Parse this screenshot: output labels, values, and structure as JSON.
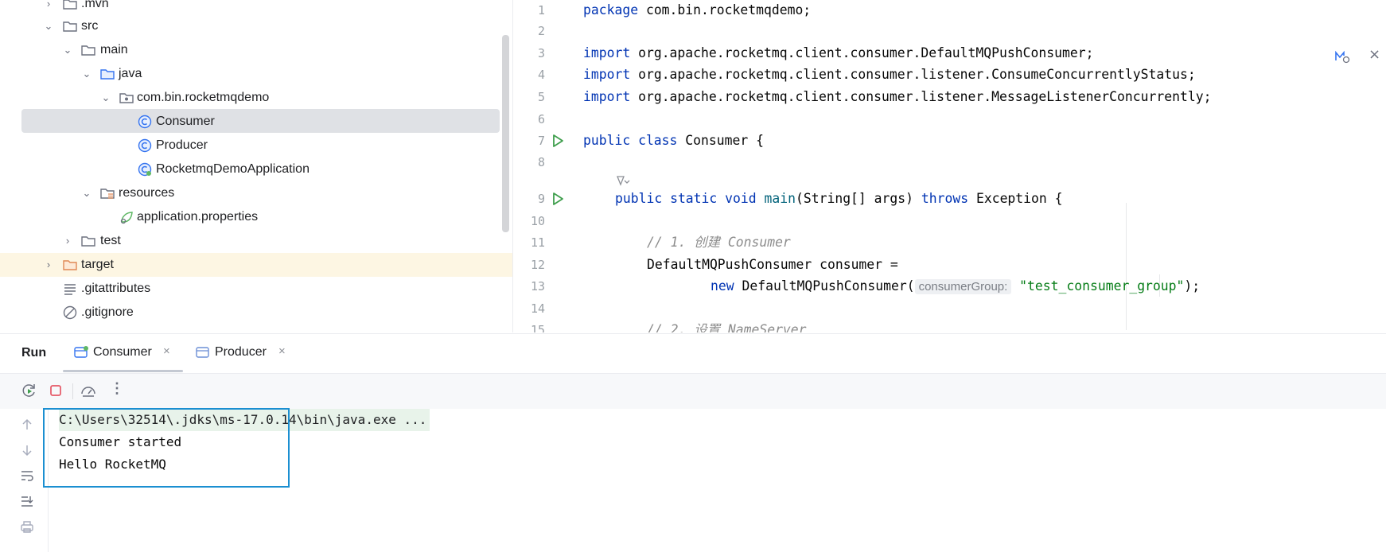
{
  "project_tree": {
    "items": [
      {
        "label": ".mvn",
        "icon": "folder-icon",
        "expanded": false
      },
      {
        "label": "src",
        "icon": "folder-icon",
        "expanded": true
      },
      {
        "label": "main",
        "icon": "folder-icon",
        "expanded": true
      },
      {
        "label": "java",
        "icon": "source-folder-icon",
        "expanded": true
      },
      {
        "label": "com.bin.rocketmqdemo",
        "icon": "package-icon",
        "expanded": true
      },
      {
        "label": "Consumer",
        "icon": "java-class-icon",
        "selected": true
      },
      {
        "label": "Producer",
        "icon": "java-class-icon"
      },
      {
        "label": "RocketmqDemoApplication",
        "icon": "spring-class-icon"
      },
      {
        "label": "resources",
        "icon": "resources-folder-icon",
        "expanded": true
      },
      {
        "label": "application.properties",
        "icon": "spring-properties-icon"
      },
      {
        "label": "test",
        "icon": "folder-icon",
        "expanded": false
      },
      {
        "label": "target",
        "icon": "excluded-folder-icon",
        "expanded": false
      },
      {
        "label": ".gitattributes",
        "icon": "text-file-icon"
      },
      {
        "label": ".gitignore",
        "icon": "ignore-file-icon"
      }
    ]
  },
  "editor": {
    "line_numbers": [
      "1",
      "2",
      "3",
      "4",
      "5",
      "6",
      "7",
      "8",
      "9",
      "10",
      "11",
      "12",
      "13",
      "14",
      "15"
    ],
    "code": {
      "l1_kw": "package",
      "l1_rest": " com.bin.rocketmqdemo;",
      "l3_kw": "import",
      "l3_rest": " org.apache.rocketmq.client.consumer.DefaultMQPushConsumer;",
      "l4_kw": "import",
      "l4_rest": " org.apache.rocketmq.client.consumer.listener.ConsumeConcurrentlyStatus;",
      "l5_kw": "import",
      "l5_rest": " org.apache.rocketmq.client.consumer.listener.MessageListenerConcurrently;",
      "l7_kw": "public class",
      "l7_rest": " Consumer {",
      "l9_kw": "public static void",
      "l9_fn": "main",
      "l9_mid": "(String[] args) ",
      "l9_kw2": "throws",
      "l9_rest": " Exception {",
      "l11_comment": "// 1. 创建 Consumer",
      "l12": "DefaultMQPushConsumer consumer =",
      "l13_kw": "new",
      "l13_mid": " DefaultMQPushConsumer(",
      "l13_hint": "consumerGroup:",
      "l13_str": "\"test_consumer_group\"",
      "l13_end": ");",
      "l15_comment": "// 2. 设置 NameServer"
    }
  },
  "run_panel": {
    "title": "Run",
    "tabs": [
      {
        "label": "Consumer",
        "active": true
      },
      {
        "label": "Producer",
        "active": false
      }
    ],
    "console_lines": [
      "C:\\Users\\32514\\.jdks\\ms-17.0.14\\bin\\java.exe ...",
      "Consumer started",
      "Hello RocketMQ"
    ]
  },
  "colors": {
    "selection_frame": "#1b8fd1",
    "keyword": "#0033b3",
    "string": "#067d17",
    "comment": "#8c8c8c"
  }
}
